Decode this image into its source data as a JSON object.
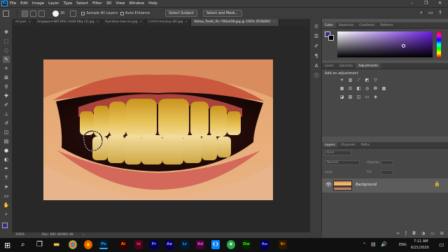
{
  "app": {
    "logo": "Ps",
    "menu": [
      "File",
      "Edit",
      "Image",
      "Layer",
      "Type",
      "Select",
      "Filter",
      "3D",
      "View",
      "Window",
      "Help"
    ],
    "window_controls": [
      "–",
      "❐",
      "✕"
    ]
  },
  "options": {
    "brush_size": "30",
    "sample_all_layers": "Sample All Layers",
    "auto_enhance": "Auto-Enhance",
    "select_subject": "Select Subject",
    "select_and_mask": "Select and Mask..."
  },
  "tabs": [
    {
      "label": "ml.psd",
      "active": false
    },
    {
      "label": "Singapore-BEFORE-1440-68q (3).jpg",
      "active": false
    },
    {
      "label": "Eye-blue-low-res.jpg",
      "active": false
    },
    {
      "label": "t-shirt-mockup-(8).jpg",
      "active": false
    },
    {
      "label": "Yellow_Teeth_Pic-700x438.jpg @ 100% (RGB/8#)",
      "active": true
    }
  ],
  "tab_close": "×",
  "status": {
    "zoom": "100%",
    "doc": "Doc: 881.4K/881.4K"
  },
  "panels": {
    "color_tabs": [
      "Color",
      "Swatches",
      "Gradients",
      "Patterns"
    ],
    "adjust_tabs": [
      "Learn",
      "Libraries",
      "Adjustments"
    ],
    "add_adjustment": "Add an adjustment",
    "layers_tabs": [
      "Layers",
      "Channels",
      "Paths"
    ],
    "kind_placeholder": "Kind",
    "blend_mode": "Normal",
    "opacity_label": "Opacity:",
    "lock_label": "Lock:",
    "fill_label": "Fill:",
    "layer_name": "Background"
  },
  "taskbar": {
    "time": "7:11 AM",
    "date": "6/21/2020",
    "lang": "ENG",
    "apps": [
      "Ps",
      "Ai",
      "Id",
      "Pr",
      "Ae",
      "Lr",
      "Xd",
      "Dw",
      "Au",
      "Br"
    ]
  },
  "colors": {
    "ps_blue": "#31a8ff",
    "picker_hue": "#6a1fe0",
    "foreground": "#3b2a8c"
  }
}
